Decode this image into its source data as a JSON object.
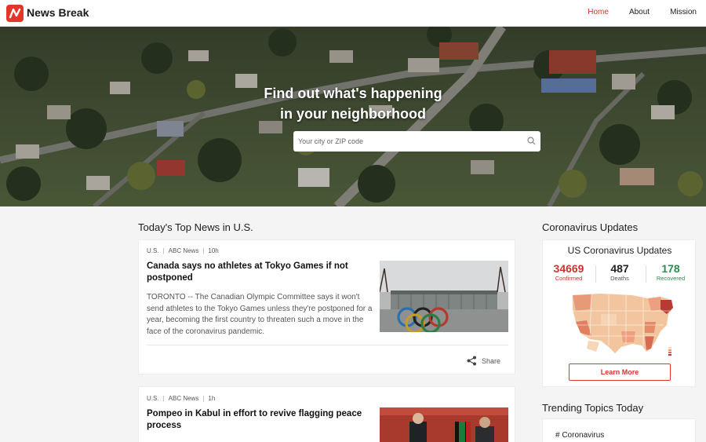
{
  "header": {
    "brand": "News Break",
    "nav": [
      {
        "label": "Home",
        "active": true
      },
      {
        "label": "About",
        "active": false
      },
      {
        "label": "Mission",
        "active": false
      }
    ]
  },
  "hero": {
    "title_line1": "Find out what's happening",
    "title_line2": "in your neighborhood",
    "search_placeholder": "Your city or ZIP code"
  },
  "top_news": {
    "heading": "Today's Top News in U.S.",
    "articles": [
      {
        "region": "U.S.",
        "source": "ABC News",
        "age": "10h",
        "headline": "Canada says no athletes at Tokyo Games if not postponed",
        "summary": "TORONTO -- The Canadian Olympic Committee says it won't send athletes to the Tokyo Games unless they're postponed for a year, becoming the first country to threaten such a move in the face of the coronavirus pandemic.",
        "share_label": "Share",
        "image": "olympic-rings-photo"
      },
      {
        "region": "U.S.",
        "source": "ABC News",
        "age": "1h",
        "headline": "Pompeo in Kabul in effort to revive flagging peace process",
        "image": "officials-meeting-photo"
      }
    ]
  },
  "corona": {
    "heading": "Coronavirus Updates",
    "card_title": "US Coronavirus Updates",
    "confirmed": {
      "value": "34669",
      "label": "Confirmed",
      "color": "#c8362b"
    },
    "deaths": {
      "value": "487",
      "label": "Deaths",
      "color": "#222222"
    },
    "recovered": {
      "value": "178",
      "label": "Recovered",
      "color": "#2e8a4f"
    },
    "button": "Learn More"
  },
  "trending": {
    "heading": "Trending Topics Today",
    "items": [
      "# Coronavirus"
    ]
  },
  "colors": {
    "accent": "#e2362b",
    "background": "#f4f4f4"
  }
}
